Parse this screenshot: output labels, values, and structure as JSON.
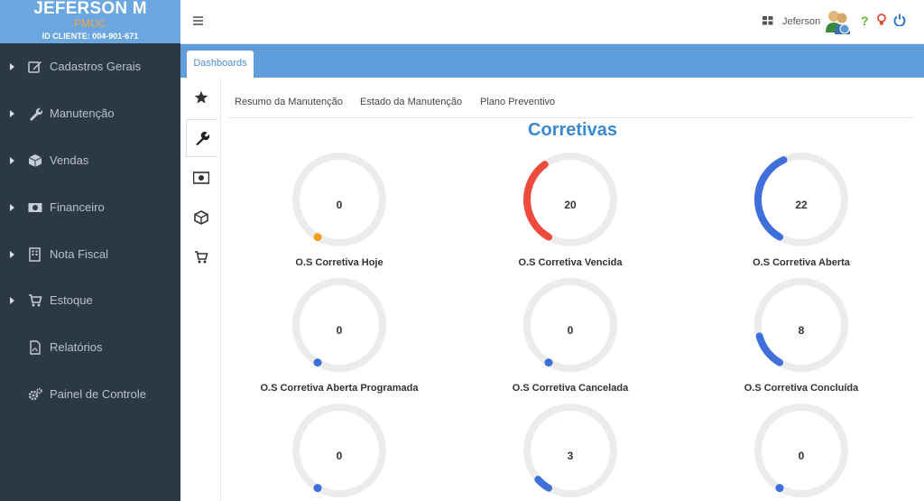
{
  "brand": {
    "name": "JEFERSON M",
    "subtitle": "PMOC",
    "client_id": "ID CLIENTE: 004-901-671"
  },
  "sidebar": {
    "items": [
      {
        "label": "Cadastros Gerais",
        "icon": "edit-icon",
        "expandable": true
      },
      {
        "label": "Manutenção",
        "icon": "wrench-icon",
        "expandable": true
      },
      {
        "label": "Vendas",
        "icon": "cube-icon",
        "expandable": true
      },
      {
        "label": "Financeiro",
        "icon": "money-icon",
        "expandable": true
      },
      {
        "label": "Nota Fiscal",
        "icon": "building-icon",
        "expandable": true
      },
      {
        "label": "Estoque",
        "icon": "cart-icon",
        "expandable": true
      },
      {
        "label": "Relatórios",
        "icon": "pdf-icon",
        "expandable": false
      },
      {
        "label": "Painel de Controle",
        "icon": "cogs-icon",
        "expandable": false
      }
    ]
  },
  "topbar": {
    "user_name": "Jeferson",
    "help": "?"
  },
  "tabs": {
    "dashboards": "Dashboards"
  },
  "subtabs": [
    "Resumo da Manutenção",
    "Estado da Manutenção",
    "Plano Preventivo"
  ],
  "section": {
    "title": "Corretivas"
  },
  "colors": {
    "accent": "#3b8ad0",
    "red": "#ee4a3d",
    "blue": "#3f6fdb",
    "orange": "#f4a01c",
    "track": "#ececec"
  },
  "gauges": [
    {
      "label": "O.S Corretiva Hoje",
      "value": "0",
      "fraction": 0,
      "color": "#f4a01c"
    },
    {
      "label": "O.S Corretiva Vencida",
      "value": "20",
      "fraction": 0.38,
      "color": "#ee4a3d"
    },
    {
      "label": "O.S Corretiva Aberta",
      "value": "22",
      "fraction": 0.42,
      "color": "#3f6fdb"
    },
    {
      "label": "O.S Corretiva Aberta Programada",
      "value": "0",
      "fraction": 0,
      "color": "#3f6fdb"
    },
    {
      "label": "O.S Corretiva Cancelada",
      "value": "0",
      "fraction": 0,
      "color": "#3f6fdb"
    },
    {
      "label": "O.S Corretiva Concluída",
      "value": "8",
      "fraction": 0.15,
      "color": "#3f6fdb"
    },
    {
      "label": "",
      "value": "0",
      "fraction": 0,
      "color": "#3f6fdb"
    },
    {
      "label": "",
      "value": "3",
      "fraction": 0.06,
      "color": "#3f6fdb"
    },
    {
      "label": "",
      "value": "0",
      "fraction": 0,
      "color": "#3f6fdb"
    }
  ]
}
